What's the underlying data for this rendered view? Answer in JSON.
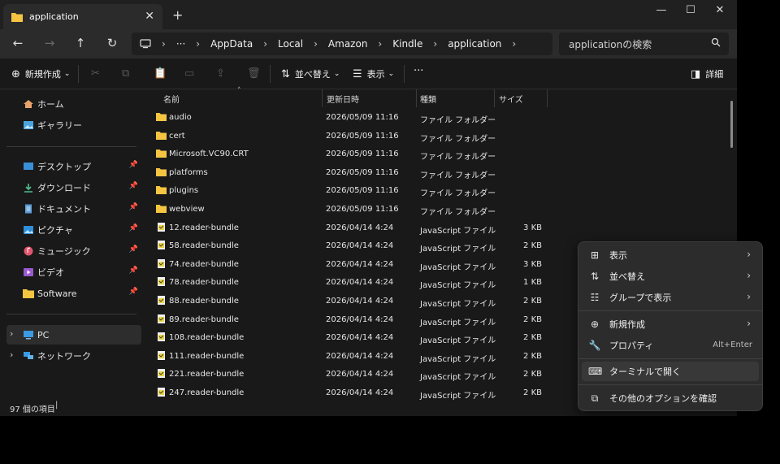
{
  "tab": {
    "title": "application",
    "close": "✕",
    "new": "+"
  },
  "window_controls": {
    "minimize": "—",
    "maximize": "☐",
    "close": "✕"
  },
  "nav": {
    "back": "←",
    "forward": "→",
    "up": "↑",
    "refresh": "↻"
  },
  "breadcrumb": {
    "more": "···",
    "items": [
      "AppData",
      "Local",
      "Amazon",
      "Kindle",
      "application"
    ]
  },
  "search": {
    "placeholder": "applicationの検索"
  },
  "toolbar": {
    "new_label": "新規作成",
    "sort_label": "並べ替え",
    "view_label": "表示",
    "more_label": "···",
    "details_label": "詳細"
  },
  "sidebar": {
    "home": "ホーム",
    "gallery": "ギャラリー",
    "desktop": "デスクトップ",
    "downloads": "ダウンロード",
    "documents": "ドキュメント",
    "pictures": "ピクチャ",
    "music": "ミュージック",
    "videos": "ビデオ",
    "software": "Software",
    "pc": "PC",
    "network": "ネットワーク"
  },
  "columns": {
    "name": "名前",
    "modified": "更新日時",
    "type": "種類",
    "size": "サイズ"
  },
  "files": [
    {
      "name": "audio",
      "modified": "2026/05/09 11:16",
      "type": "ファイル フォルダー",
      "size": "",
      "kind": "folder"
    },
    {
      "name": "cert",
      "modified": "2026/05/09 11:16",
      "type": "ファイル フォルダー",
      "size": "",
      "kind": "folder"
    },
    {
      "name": "Microsoft.VC90.CRT",
      "modified": "2026/05/09 11:16",
      "type": "ファイル フォルダー",
      "size": "",
      "kind": "folder"
    },
    {
      "name": "platforms",
      "modified": "2026/05/09 11:16",
      "type": "ファイル フォルダー",
      "size": "",
      "kind": "folder"
    },
    {
      "name": "plugins",
      "modified": "2026/05/09 11:16",
      "type": "ファイル フォルダー",
      "size": "",
      "kind": "folder"
    },
    {
      "name": "webview",
      "modified": "2026/05/09 11:16",
      "type": "ファイル フォルダー",
      "size": "",
      "kind": "folder"
    },
    {
      "name": "12.reader-bundle",
      "modified": "2026/04/14 4:24",
      "type": "JavaScript ファイル",
      "size": "3 KB",
      "kind": "js"
    },
    {
      "name": "58.reader-bundle",
      "modified": "2026/04/14 4:24",
      "type": "JavaScript ファイル",
      "size": "2 KB",
      "kind": "js"
    },
    {
      "name": "74.reader-bundle",
      "modified": "2026/04/14 4:24",
      "type": "JavaScript ファイル",
      "size": "3 KB",
      "kind": "js"
    },
    {
      "name": "78.reader-bundle",
      "modified": "2026/04/14 4:24",
      "type": "JavaScript ファイル",
      "size": "1 KB",
      "kind": "js"
    },
    {
      "name": "88.reader-bundle",
      "modified": "2026/04/14 4:24",
      "type": "JavaScript ファイル",
      "size": "2 KB",
      "kind": "js"
    },
    {
      "name": "89.reader-bundle",
      "modified": "2026/04/14 4:24",
      "type": "JavaScript ファイル",
      "size": "2 KB",
      "kind": "js"
    },
    {
      "name": "108.reader-bundle",
      "modified": "2026/04/14 4:24",
      "type": "JavaScript ファイル",
      "size": "2 KB",
      "kind": "js"
    },
    {
      "name": "111.reader-bundle",
      "modified": "2026/04/14 4:24",
      "type": "JavaScript ファイル",
      "size": "2 KB",
      "kind": "js"
    },
    {
      "name": "221.reader-bundle",
      "modified": "2026/04/14 4:24",
      "type": "JavaScript ファイル",
      "size": "2 KB",
      "kind": "js"
    },
    {
      "name": "247.reader-bundle",
      "modified": "2026/04/14 4:24",
      "type": "JavaScript ファイル",
      "size": "2 KB",
      "kind": "js"
    }
  ],
  "status": {
    "count": "97 個の項目"
  },
  "context_menu": {
    "view": "表示",
    "sort": "並べ替え",
    "group": "グループで表示",
    "new": "新規作成",
    "properties": "プロパティ",
    "properties_shortcut": "Alt+Enter",
    "terminal": "ターミナルで開く",
    "more_options": "その他のオプションを確認"
  },
  "colors": {
    "background": "#191919",
    "accent": "#4cc2ff",
    "folder": "#f5c542"
  }
}
